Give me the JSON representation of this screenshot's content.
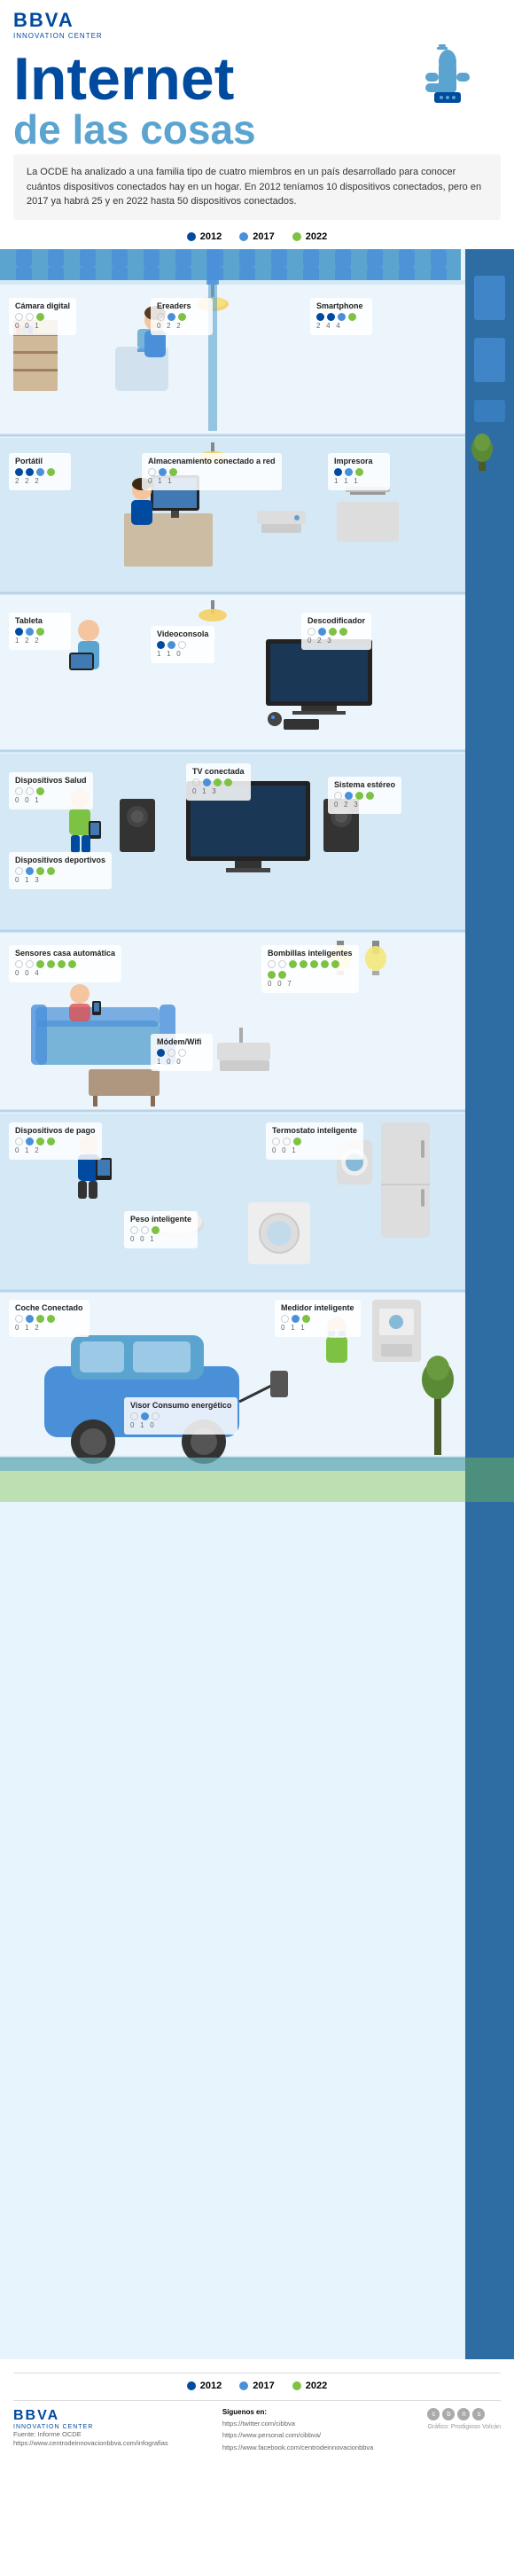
{
  "header": {
    "bbva_label": "BBVA",
    "innovation_label": "INNOVATION CENTER"
  },
  "hero": {
    "title_line1": "Internet",
    "title_line2": "de las cosas"
  },
  "description": {
    "text": "La OCDE ha analizado a una familia tipo de cuatro miembros en un país desarrollado para conocer cuántos dispositivos conectados hay en un hogar. En 2012 teníamos 10 dispositivos conectados, pero en 2017 ya habrá 25 y en 2022 hasta 50 dispositivos conectados."
  },
  "legend": {
    "year2012": "2012",
    "year2017": "2017",
    "year2022": "2022"
  },
  "devices": {
    "camara_digital": {
      "name": "Cámara digital",
      "d2012": 0,
      "d2017": 0,
      "d2022": 1
    },
    "ereaders": {
      "name": "Ereaders",
      "d2012": 0,
      "d2017": 2,
      "d2022": 2
    },
    "smartphone": {
      "name": "Smartphone",
      "d2012": 2,
      "d2017": 4,
      "d2022": 4
    },
    "portatil": {
      "name": "Portátil",
      "d2012": 2,
      "d2017": 2,
      "d2022": 2
    },
    "almacenamiento": {
      "name": "Almacenamiento conectado a red",
      "d2012": 0,
      "d2017": 1,
      "d2022": 1
    },
    "impresora": {
      "name": "Impresora",
      "d2012": 1,
      "d2017": 1,
      "d2022": 1
    },
    "tableta": {
      "name": "Tableta",
      "d2012": 1,
      "d2017": 2,
      "d2022": 2
    },
    "videoconsola": {
      "name": "Videoconsola",
      "d2012": 1,
      "d2017": 1,
      "d2022": 0
    },
    "descodificador": {
      "name": "Descodificador",
      "d2012": 0,
      "d2017": 2,
      "d2022": 3
    },
    "tv_conectada": {
      "name": "TV conectada",
      "d2012": 0,
      "d2017": 1,
      "d2022": 3
    },
    "dispositivos_salud": {
      "name": "Dispositivos Salud",
      "d2012": 0,
      "d2017": 0,
      "d2022": 1
    },
    "sistema_estereo": {
      "name": "Sistema estéreo",
      "d2012": 0,
      "d2017": 2,
      "d2022": 3
    },
    "dispositivos_deportivos": {
      "name": "Dispositivos deportivos",
      "d2012": 0,
      "d2017": 1,
      "d2022": 3
    },
    "sensores_casa": {
      "name": "Sensores casa automática",
      "d2012": 0,
      "d2017": 0,
      "d2022": 4
    },
    "bombillas": {
      "name": "Bombillas inteligentes",
      "d2012": 0,
      "d2017": 0,
      "d2022": 7
    },
    "modem_wifi": {
      "name": "Módem/Wifi",
      "d2012": 1,
      "d2017": 0,
      "d2022": 0
    },
    "dispositivos_pago": {
      "name": "Dispositivos de pago",
      "d2012": 0,
      "d2017": 1,
      "d2022": 2
    },
    "termostato": {
      "name": "Termostato inteligente",
      "d2012": 0,
      "d2017": 0,
      "d2022": 1
    },
    "peso_inteligente": {
      "name": "Peso inteligente",
      "d2012": 0,
      "d2017": 0,
      "d2022": 1
    },
    "coche_conectado": {
      "name": "Coche Conectado",
      "d2012": 0,
      "d2017": 1,
      "d2022": 2
    },
    "visor_consumo": {
      "name": "Visor Consumo energético",
      "d2012": 0,
      "d2017": 1,
      "d2022": 0
    },
    "medidor_inteligente": {
      "name": "Medidor inteligente",
      "d2012": 0,
      "d2017": 1,
      "d2022": 1
    }
  },
  "footer": {
    "bbva_label": "BBVA",
    "innovation_label": "INNOVATION CENTER",
    "source_label": "Fuente: Informe OCDE",
    "source_url": "https://www.centrodeinnovacionbbva.com/infografias",
    "social_twitter": "https://twitter.com/cibbva",
    "social_web": "https://www.personal.com/cibbva/",
    "social_facebook": "https://www.facebook.com/centrodeinnovacionbbva",
    "credit": "Gráfico: Prodigioso Volcán"
  }
}
